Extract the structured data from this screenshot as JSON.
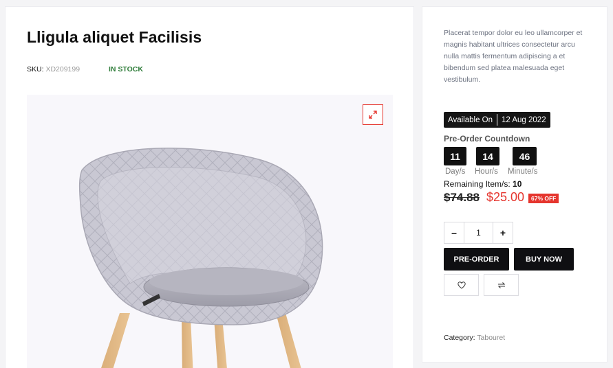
{
  "product": {
    "title": "Lligula aliquet Facilisis",
    "sku_label": "SKU:",
    "sku_value": "XD209199",
    "stock_status": "IN STOCK",
    "description": "Placerat tempor dolor eu leo ullamcorper et magnis habitant ultrices consectetur arcu nulla mattis fermentum adipiscing a et bibendum sed platea malesuada eget vestibulum.",
    "image_alt": "Grey quilted chair with wooden legs"
  },
  "availability": {
    "label": "Available On",
    "date": "12 Aug 2022"
  },
  "countdown": {
    "title": "Pre-Order Countdown",
    "days": "11",
    "hours": "14",
    "minutes": "46",
    "days_label": "Day/s",
    "hours_label": "Hour/s",
    "minutes_label": "Minute/s"
  },
  "stock": {
    "remaining_label": "Remaining Item/s:",
    "remaining_value": "10"
  },
  "pricing": {
    "old_price": "$74.88",
    "new_price": "$25.00",
    "discount": "67% OFF"
  },
  "quantity": {
    "value": "1",
    "minus": "–",
    "plus": "+"
  },
  "actions": {
    "preorder_label": "PRE-ORDER",
    "buynow_label": "BUY NOW"
  },
  "meta": {
    "category_label": "Category:",
    "category_value": "Tabouret"
  },
  "colors": {
    "accent_red": "#e5352e",
    "stock_green": "#2f7d3a",
    "button_dark": "#0f0f12"
  },
  "icons": {
    "zoom": "expand-icon",
    "wishlist": "heart-icon",
    "compare": "swap-arrows-icon"
  }
}
